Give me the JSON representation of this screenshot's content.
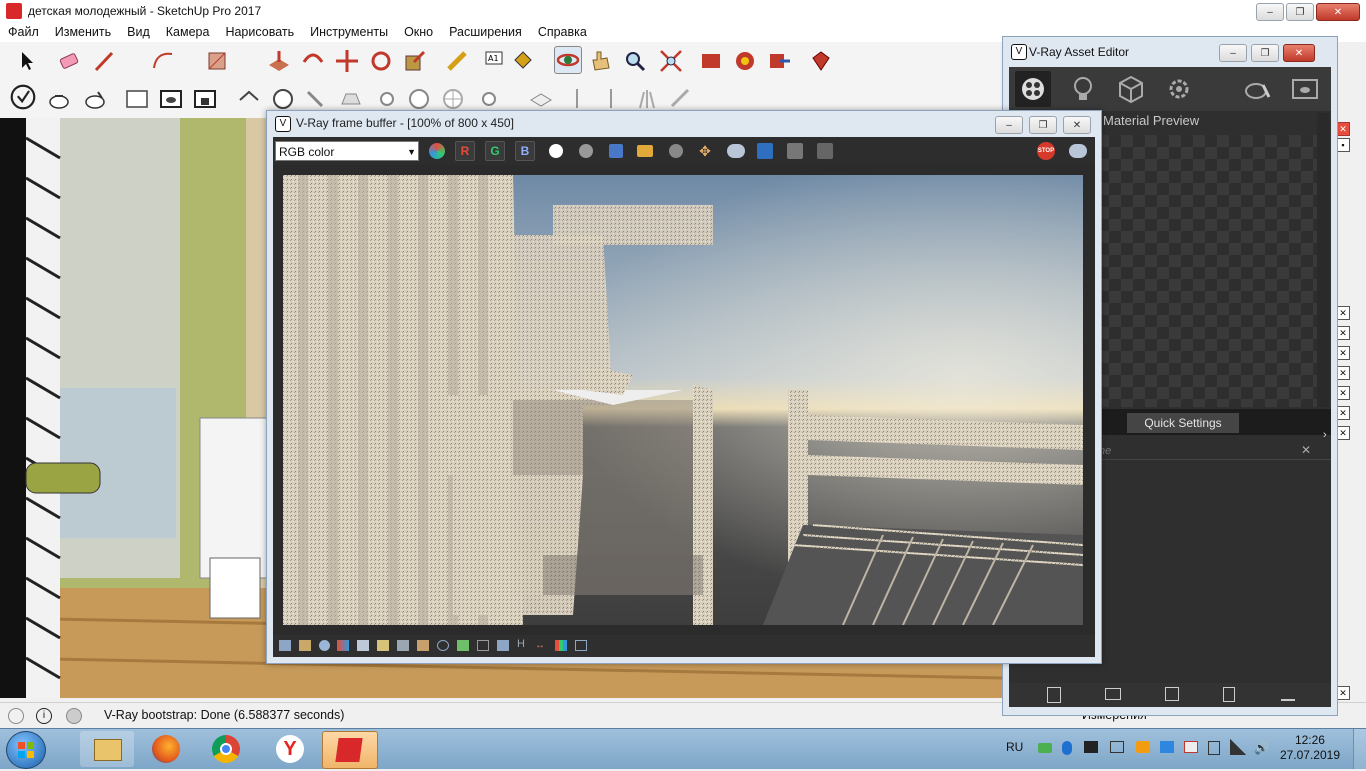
{
  "sketchup": {
    "title": "детская молодежный - SketchUp Pro 2017",
    "menu": [
      "Файл",
      "Изменить",
      "Вид",
      "Камера",
      "Нарисовать",
      "Инструменты",
      "Окно",
      "Расширения",
      "Справка"
    ],
    "status_text": "V-Ray bootstrap: Done (6.588377 seconds)",
    "measurements_label": "Измерения"
  },
  "vfb": {
    "title": "V-Ray frame buffer - [100% of 800 x 450]",
    "channel": "RGB color",
    "channel_buttons": [
      "R",
      "G",
      "B"
    ],
    "bottom_h": "H"
  },
  "asset_editor": {
    "title": "V-Ray Asset Editor",
    "material_preview": "Material Preview",
    "quick_settings": "Quick Settings",
    "name_placeholder": "ne"
  },
  "taskbar": {
    "lang": "RU",
    "time": "12:26",
    "date": "27.07.2019"
  },
  "icons": {
    "sketchup_logo": "sketchup-logo-icon",
    "vray_logo": "vray-logo-icon"
  },
  "colors": {
    "sketchup_red": "#d8282a",
    "vray_dark": "#2f2f2f",
    "taskbar": "#8fb3d3",
    "stop_red": "#d63a2a"
  }
}
